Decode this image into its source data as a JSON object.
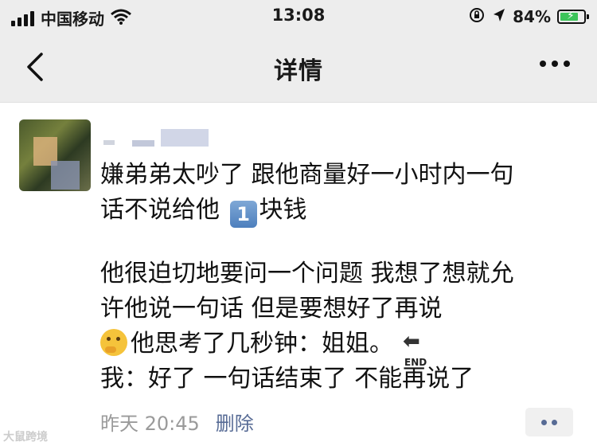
{
  "status_bar": {
    "carrier": "中国移动",
    "time": "13:08",
    "battery_percent": "84%",
    "battery_level": 0.84,
    "icons": [
      "signal-icon",
      "wifi-icon",
      "lock-rotation-icon",
      "location-icon",
      "battery-charging-icon"
    ]
  },
  "nav": {
    "title": "详情",
    "back_icon": "chevron-left-icon",
    "more_icon": "more-dots-icon"
  },
  "post": {
    "lines": [
      "嫌弟弟太吵了 跟他商量好一小时内一句",
      "话不说给他",
      "块钱"
    ],
    "keycap_number": "1",
    "para2_line1": "他很迫切地要问一个问题 我想了想就允",
    "para2_line2": "许他说一句话 但是要想好了再说",
    "para2_line3": "他思考了几秒钟：姐姐。",
    "end_label": "END",
    "para2_line4": "我：好了 一句话结束了 不能再说了",
    "timestamp": "昨天 20:45",
    "delete_label": "删除"
  },
  "watermark": "大鼠跨境",
  "colors": {
    "bar_bg": "#ededed",
    "link": "#576b95",
    "battery": "#3cc45a"
  }
}
